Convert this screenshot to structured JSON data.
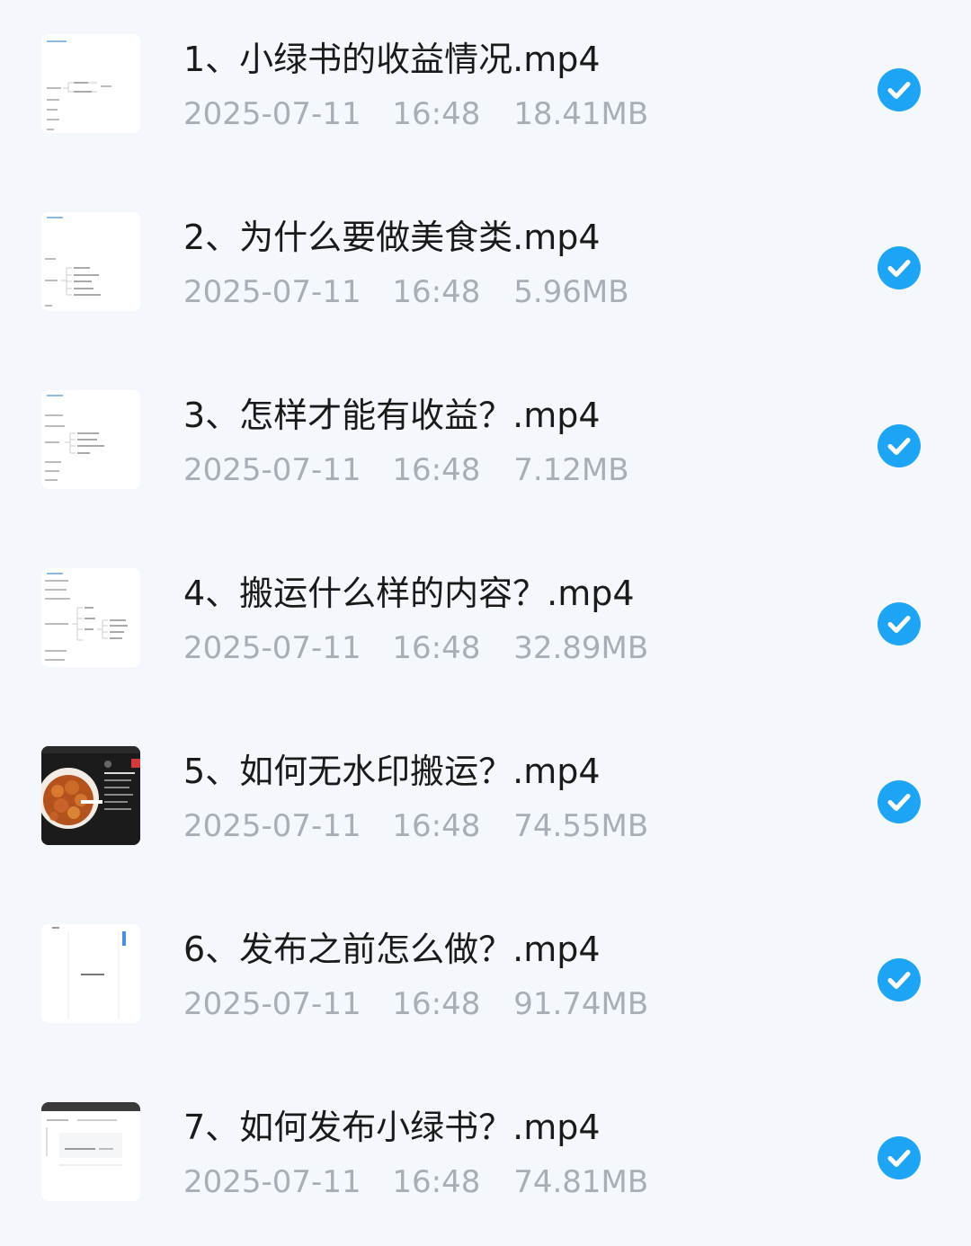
{
  "files": [
    {
      "name": "1、小绿书的收益情况.mp4",
      "date": "2025-07-11",
      "time": "16:48",
      "size": "18.41MB",
      "selected": true,
      "thumbnail": "mindmap-icon"
    },
    {
      "name": "2、为什么要做美食类.mp4",
      "date": "2025-07-11",
      "time": "16:48",
      "size": "5.96MB",
      "selected": true,
      "thumbnail": "mindmap-icon"
    },
    {
      "name": "3、怎样才能有收益？.mp4",
      "date": "2025-07-11",
      "time": "16:48",
      "size": "7.12MB",
      "selected": true,
      "thumbnail": "mindmap-icon"
    },
    {
      "name": "4、搬运什么样的内容？.mp4",
      "date": "2025-07-11",
      "time": "16:48",
      "size": "32.89MB",
      "selected": true,
      "thumbnail": "mindmap-icon"
    },
    {
      "name": "5、如何无水印搬运？.mp4",
      "date": "2025-07-11",
      "time": "16:48",
      "size": "74.55MB",
      "selected": true,
      "thumbnail": "food-video-icon"
    },
    {
      "name": "6、发布之前怎么做？.mp4",
      "date": "2025-07-11",
      "time": "16:48",
      "size": "91.74MB",
      "selected": true,
      "thumbnail": "document-icon"
    },
    {
      "name": "7、如何发布小绿书？.mp4",
      "date": "2025-07-11",
      "time": "16:48",
      "size": "74.81MB",
      "selected": true,
      "thumbnail": "dark-header-doc-icon"
    }
  ],
  "colors": {
    "background": "#f4f8fc",
    "check_blue": "#1ea4f5",
    "title_text": "#1a1a1a",
    "meta_text": "#a9aeb6"
  }
}
